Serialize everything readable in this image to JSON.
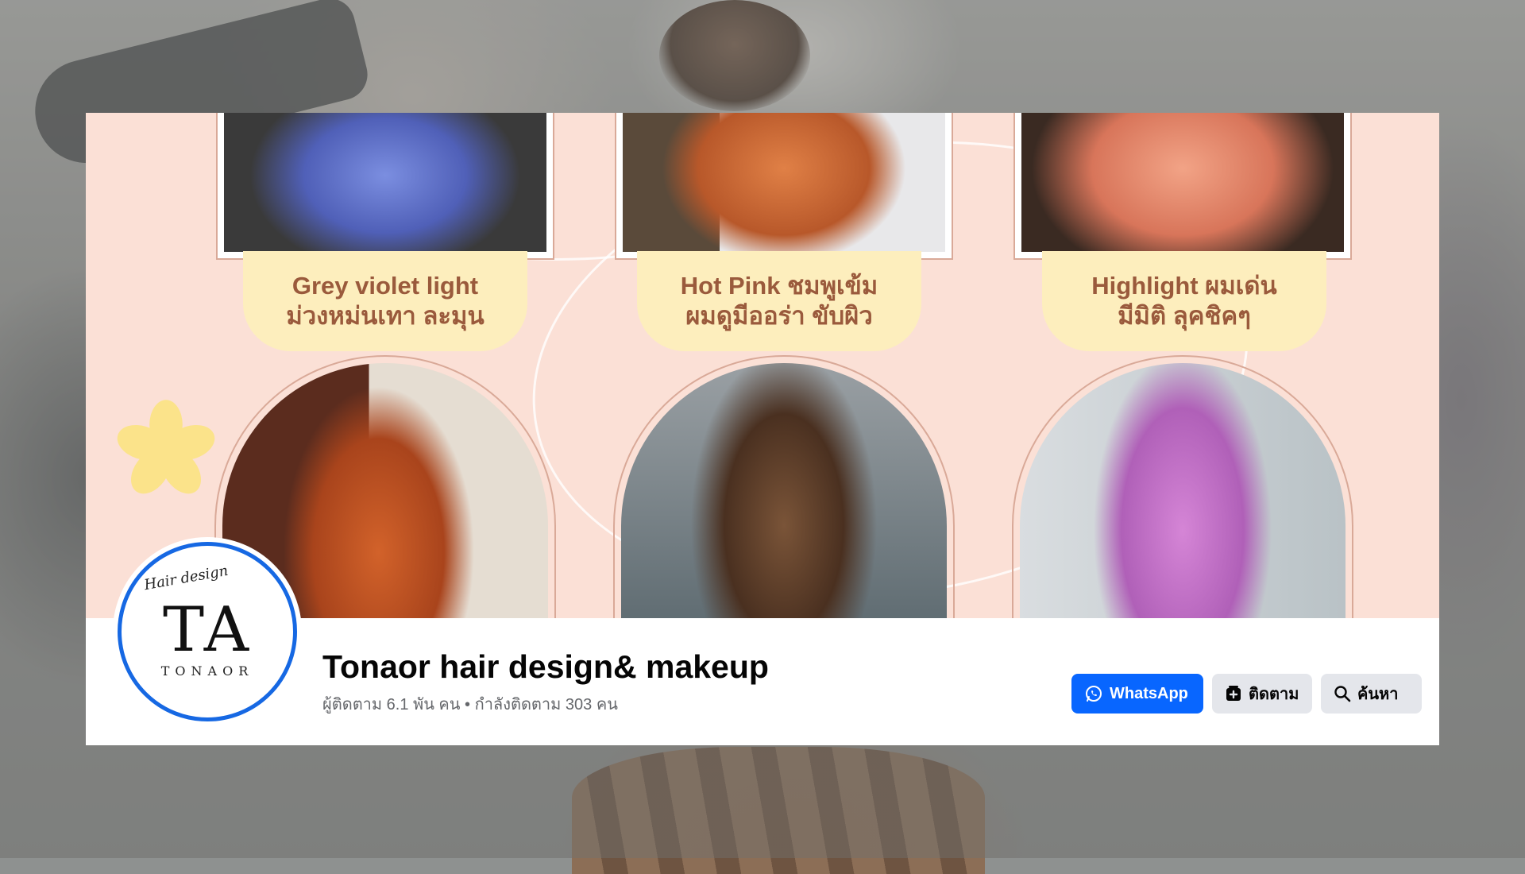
{
  "page": {
    "name": "Tonaor hair design& makeup",
    "stats": "ผู้ติดตาม 6.1 พัน คน • กำลังติดตาม 303 คน"
  },
  "logo": {
    "letters": "TA",
    "script": "Hair design",
    "brand": "TONAOR"
  },
  "cover": {
    "styles": [
      {
        "line1": "Grey violet light",
        "line2": "ม่วงหม่นเทา ละมุน",
        "top_color": "#6c7fd0",
        "bottom_color": "#c65a2a"
      },
      {
        "line1": "Hot Pink ชมพูเข้ม",
        "line2": "ผมดูมีออร่า ขับผิว",
        "top_color": "#d7743a",
        "bottom_color": "#6b4630"
      },
      {
        "line1": "Highlight ผมเด่น",
        "line2": "มีมิติ ลุคชิคๆ",
        "top_color": "#e88a6a",
        "bottom_color": "#c978c8"
      }
    ]
  },
  "actions": {
    "whatsapp": "WhatsApp",
    "follow": "ติดตาม",
    "search": "ค้นหา"
  },
  "colors": {
    "accent": "#0866ff",
    "cover_bg": "#fbe0d6",
    "label_bg": "#fdeebd",
    "label_text": "#9a5a3c"
  }
}
